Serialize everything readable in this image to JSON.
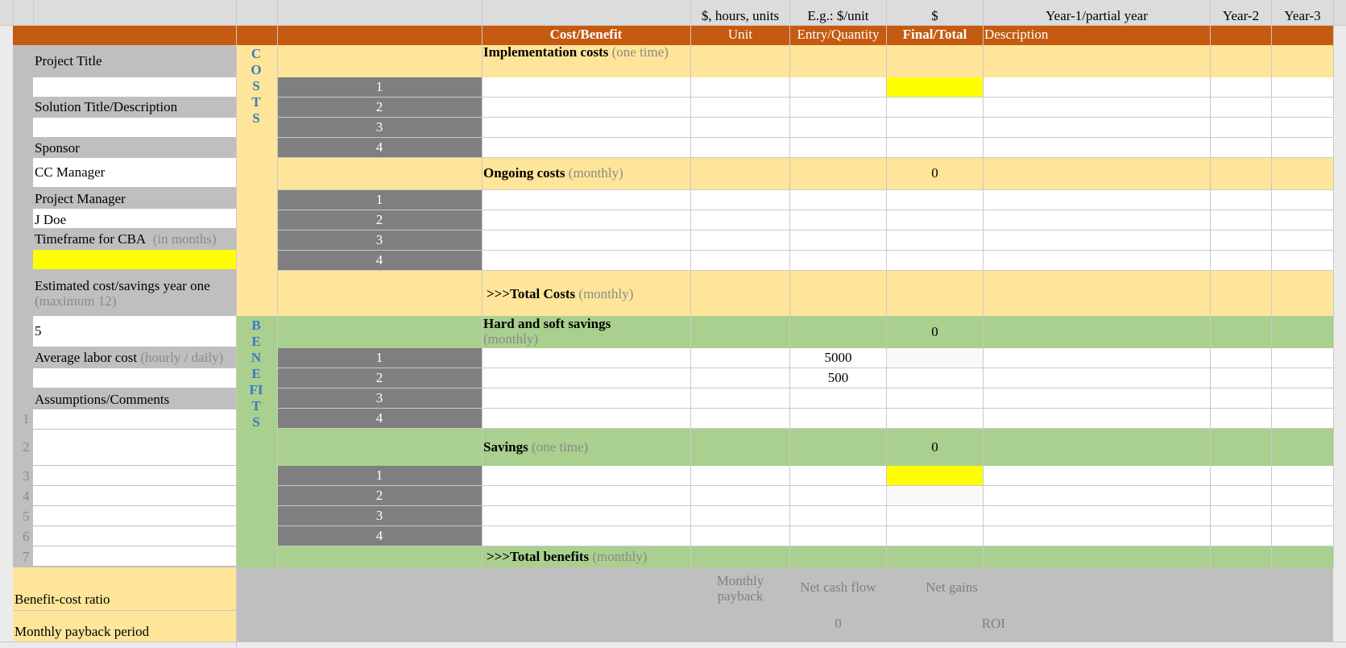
{
  "colors": {
    "header_orange": "#c55a11",
    "costs_tan": "#ffe599",
    "benefits_green": "#a9d08e",
    "label_gray": "#bfbfbf",
    "number_gray": "#7f7f7f",
    "highlight_yellow": "#ffff00",
    "vertical_text_blue": "#3b78c6"
  },
  "top_header": {
    "unit_hint": "$, hours, units",
    "entry_hint": "E.g.: $/unit",
    "final_hint": "$",
    "year1": "Year-1/partial year",
    "year2": "Year-2",
    "year3": "Year-3"
  },
  "column_header": {
    "cost_benefit": "Cost/Benefit",
    "unit": "Unit",
    "entry": "Entry/Quantity",
    "final": "Final/Total",
    "description": "Description"
  },
  "left_panel": {
    "project_title": "Project Title",
    "project_title_value": "",
    "solution_title": "Solution Title/Description",
    "solution_value": "",
    "sponsor": "Sponsor",
    "sponsor_value": "CC Manager",
    "project_manager": "Project Manager",
    "project_manager_value": "J Doe",
    "timeframe": "Timeframe for CBA",
    "timeframe_note": "(in months)",
    "estimated": "Estimated cost/savings year one",
    "estimated_note": "(maximum 12)",
    "estimated_value": "5",
    "labor": "Average labor cost",
    "labor_note": "(hourly / daily)",
    "labor_value": "",
    "assumptions": "Assumptions/Comments",
    "assumption_numbers": [
      "1",
      "2",
      "3",
      "4",
      "5",
      "6",
      "7"
    ]
  },
  "vertical_labels": {
    "costs": "COSTS",
    "benefits": "BENEFITS"
  },
  "sections": {
    "implementation": "Implementation costs",
    "implementation_note": "(one time)",
    "ongoing": "Ongoing costs",
    "ongoing_note": "(monthly)",
    "ongoing_total": "0",
    "total_costs": ">>>Total Costs",
    "total_costs_note": "(monthly)",
    "hard_soft": "Hard and soft savings",
    "hard_soft_note": "(monthly)",
    "hard_soft_total": "0",
    "savings": "Savings",
    "savings_note": "(one time)",
    "savings_total": "0",
    "total_benefits": ">>>Total benefits",
    "total_benefits_note": "(monthly)"
  },
  "row_numbers": [
    "1",
    "2",
    "3",
    "4"
  ],
  "entries": {
    "hard_soft_1": "5000",
    "hard_soft_2": "500"
  },
  "summary": {
    "benefit_cost_ratio": "Benefit-cost ratio",
    "monthly_payback_period": "Monthly payback period",
    "monthly_payback": "Monthly payback",
    "net_cash_flow": "Net cash flow",
    "net_cash_flow_value": "0",
    "net_gains": "Net gains",
    "roi": "ROI"
  }
}
